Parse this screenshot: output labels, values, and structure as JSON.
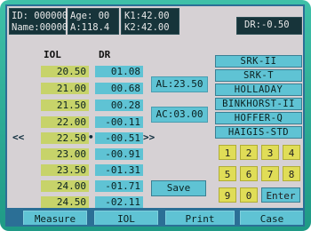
{
  "header": {
    "id_name": "ID: 000000\nName:000000",
    "age_a": "Age: 00\nA:118.4",
    "k": "K1:42.00\nK2:42.00",
    "dr": "DR:-0.50"
  },
  "table": {
    "iol_header": "IOL",
    "dr_header": "DR",
    "rows": [
      {
        "iol": "20.50",
        "dr": "01.08"
      },
      {
        "iol": "21.00",
        "dr": "00.68"
      },
      {
        "iol": "21.50",
        "dr": "00.28"
      },
      {
        "iol": "22.00",
        "dr": "-00.11"
      },
      {
        "iol": "22.50",
        "dr": "-00.51"
      },
      {
        "iol": "23.00",
        "dr": "-00.91"
      },
      {
        "iol": "23.50",
        "dr": "-01.31"
      },
      {
        "iol": "24.00",
        "dr": "-01.71"
      },
      {
        "iol": "24.50",
        "dr": "-02.11"
      }
    ],
    "left_arrows": "<<",
    "right_arrows": ">>",
    "dot": "•"
  },
  "al_ac": {
    "al": "AL:23.50",
    "ac": "AC:03.00"
  },
  "formulas": [
    "SRK-II",
    "SRK-T",
    "HOLLADAY",
    "BINKHORST-II",
    "HOFFER-Q",
    "HAIGIS-STD"
  ],
  "keypad": {
    "row1": [
      "1",
      "2",
      "3",
      "4"
    ],
    "row2": [
      "5",
      "6",
      "7",
      "8"
    ],
    "row3": [
      "9",
      "0"
    ],
    "enter": "Enter"
  },
  "save_label": "Save",
  "bottom_tabs": [
    "Measure",
    "IOL",
    "Print",
    "Case"
  ]
}
